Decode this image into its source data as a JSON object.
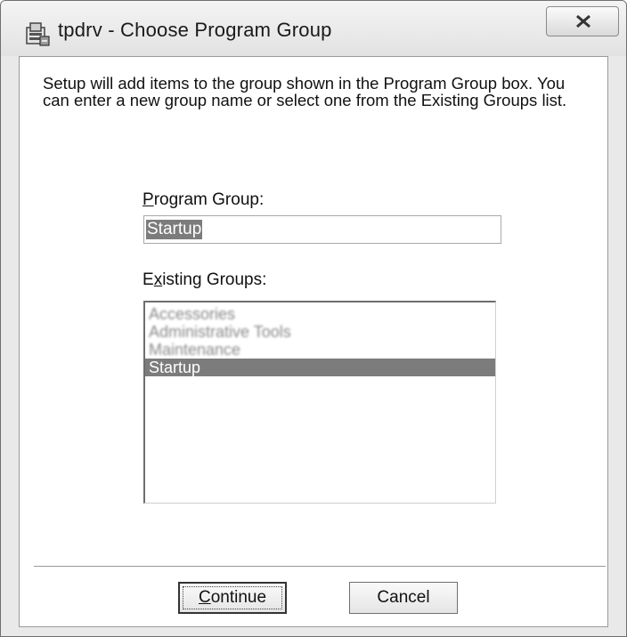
{
  "window": {
    "title": "tpdrv - Choose Program Group",
    "close_label": "X"
  },
  "description": "Setup will add items to the group shown in the Program Group box. You can enter a new group name or select one from the Existing Groups list.",
  "program_group": {
    "label_accel": "P",
    "label_rest": "rogram Group:",
    "value": "Startup"
  },
  "existing_groups": {
    "label_pre": "E",
    "label_accel": "x",
    "label_rest": "isting Groups:",
    "items": [
      {
        "label": "Accessories",
        "blurred": true
      },
      {
        "label": "Administrative Tools",
        "blurred": true
      },
      {
        "label": "Maintenance",
        "blurred": true
      },
      {
        "label": "Startup",
        "blurred": false,
        "selected": true
      }
    ]
  },
  "buttons": {
    "continue_accel": "C",
    "continue_rest": "ontinue",
    "cancel": "Cancel"
  },
  "colors": {
    "selection": "#7c7c7c",
    "client_background": "#ffffff",
    "frame": "#e9e9e9"
  },
  "icons": [
    "installer-icon",
    "close-icon"
  ]
}
